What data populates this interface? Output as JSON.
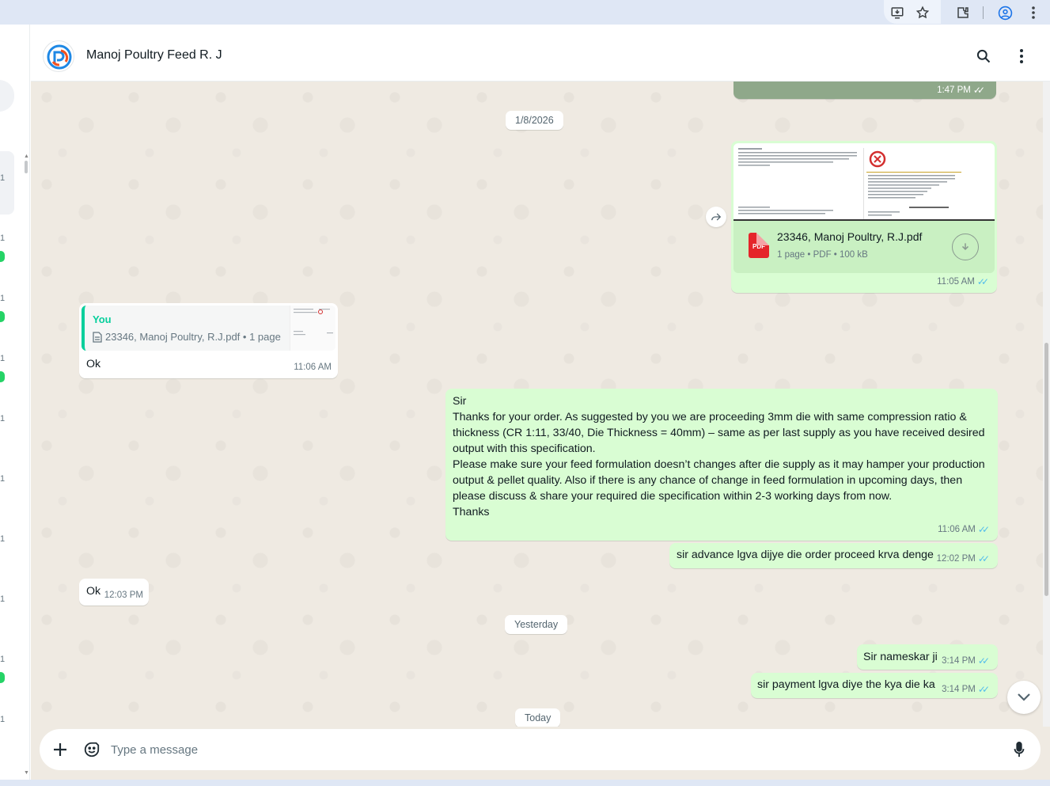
{
  "chat": {
    "title": "Manoj Poultry Feed R. J"
  },
  "messages": {
    "m0_time": "1:47 PM",
    "date1": "1/8/2026",
    "doc": {
      "name": "23346, Manoj Poultry, R.J.pdf",
      "meta": "1 page • PDF • 100 kB",
      "badge": "PDF",
      "time": "11:05 AM",
      "preview_company": "LARK ENGINEERING COMPANY (INDIA) PVT LTD",
      "preview_heading": "Proforma Invoice"
    },
    "reply": {
      "author": "You",
      "quoted": "23346, Manoj Poultry, R.J.pdf • 1 page",
      "text": "Ok",
      "time": "11:06 AM"
    },
    "long": {
      "text": "Sir\nThanks for your order. As suggested by you we are proceeding 3mm die with same compression ratio & thickness (CR 1:11, 33/40, Die Thickness = 40mm)  – same as per last supply as you have received desired output with this specification.\nPlease make sure your feed formulation doesn’t changes after die supply as it may hamper your production output & pellet quality. Also if there is any chance of change in feed formulation in upcoming days, then please discuss & share your required die specification within 2-3 working days from now.\nThanks",
      "time": "11:06 AM"
    },
    "advance": {
      "text": "sir advance lgva dijye die order proceed krva denge",
      "time": "12:02 PM"
    },
    "ok2": {
      "text": "Ok",
      "time": "12:03 PM"
    },
    "date2": "Yesterday",
    "namaskar": {
      "text": "Sir nameskar ji",
      "time": "3:14 PM"
    },
    "payment": {
      "text": "sir payment lgva diye the kya die  ka",
      "time": "3:14 PM"
    },
    "date3": "Today"
  },
  "composer": {
    "placeholder": "Type a message"
  },
  "icons": {
    "search": "search-icon",
    "menu": "kebab-menu-icon",
    "attach": "plus-icon",
    "sticker": "sticker-icon",
    "mic": "mic-icon",
    "scroll_down": "chevron-down-icon",
    "ticks_color": "#53bdeb",
    "outgoing_bubble": "#d9fdd3"
  }
}
